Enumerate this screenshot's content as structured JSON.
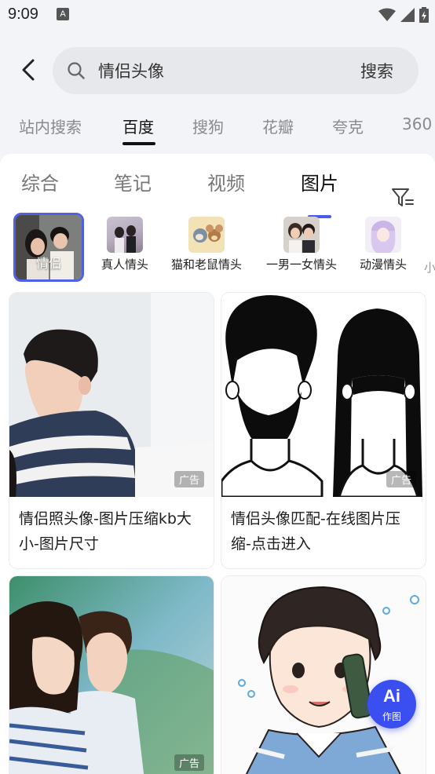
{
  "status_bar": {
    "time": "9:09",
    "notification_icon": "a-letter-icon",
    "icons": [
      "wifi-icon",
      "signal-icon",
      "battery-icon"
    ]
  },
  "search": {
    "query": "情侣头像",
    "submit_label": "搜索"
  },
  "engine_tabs": [
    {
      "label": "站内搜索",
      "active": false
    },
    {
      "label": "百度",
      "active": true
    },
    {
      "label": "搜狗",
      "active": false
    },
    {
      "label": "花瓣",
      "active": false
    },
    {
      "label": "夸克",
      "active": false
    },
    {
      "label": "360",
      "active": false
    }
  ],
  "type_tabs": [
    {
      "label": "综合",
      "active": false
    },
    {
      "label": "笔记",
      "active": false
    },
    {
      "label": "视频",
      "active": false
    },
    {
      "label": "图片",
      "active": true
    }
  ],
  "chips": [
    {
      "label": "情侣",
      "selected": true
    },
    {
      "label": "真人情头"
    },
    {
      "label": "猫和老鼠情头"
    },
    {
      "label": "一男一女情头"
    },
    {
      "label": "动漫情头"
    }
  ],
  "results": [
    {
      "caption": "情侣照头像-图片压缩kb大小-图片尺寸",
      "badge": "广告"
    },
    {
      "caption": "情侣头像匹配-在线图片压缩-点击进入",
      "badge": "广告"
    },
    {
      "caption": "",
      "badge": "广告"
    },
    {
      "caption": "",
      "badge": ""
    }
  ],
  "ai_button": {
    "logo": "Ai",
    "label": "作图"
  },
  "colors": {
    "accent": "#4a5bea",
    "background": "#f3f4f7",
    "search_box": "#e7e8ec"
  }
}
